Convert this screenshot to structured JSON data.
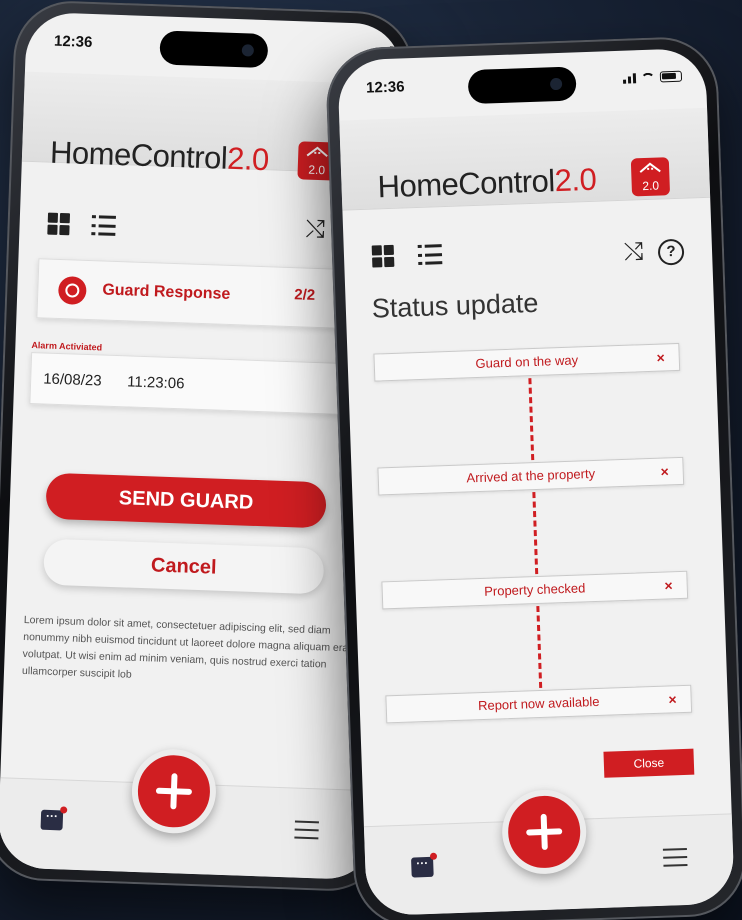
{
  "left_phone": {
    "status_time": "12:36",
    "brand": {
      "part1": "Home",
      "part2": "Control",
      "part3": "2.0"
    },
    "logo_label": "2.0",
    "guard_card": {
      "title": "Guard Response",
      "count": "2/2"
    },
    "alarm": {
      "label": "Alarm Activiated",
      "date": "16/08/23",
      "time": "11:23:06"
    },
    "send_label": "SEND GUARD",
    "cancel_label": "Cancel",
    "lorem": "Lorem ipsum dolor sit amet, consectetuer adipiscing elit, sed diam nonummy nibh euismod tincidunt ut laoreet dolore magna aliquam erat volutpat. Ut wisi enim ad minim veniam, quis nostrud exerci tation ullamcorper suscipit lob"
  },
  "right_phone": {
    "status_time": "12:36",
    "brand": {
      "part1": "Home",
      "part2": "Control",
      "part3": "2.0"
    },
    "logo_label": "2.0",
    "help_label": "?",
    "heading": "Status update",
    "steps": [
      {
        "label": "Guard on the way",
        "remove": "×"
      },
      {
        "label": "Arrived at the property",
        "remove": "×"
      },
      {
        "label": "Property checked",
        "remove": "×"
      },
      {
        "label": "Report now available",
        "remove": "×"
      }
    ],
    "close_label": "Close"
  },
  "colors": {
    "accent": "#d01e22",
    "background": "#1a2538",
    "screen": "#f1f1f1"
  },
  "icons": [
    "grid-icon",
    "list-icon",
    "shuffle-icon",
    "help-icon",
    "chat-icon",
    "menu-icon",
    "plus-icon",
    "home-logo-icon"
  ]
}
